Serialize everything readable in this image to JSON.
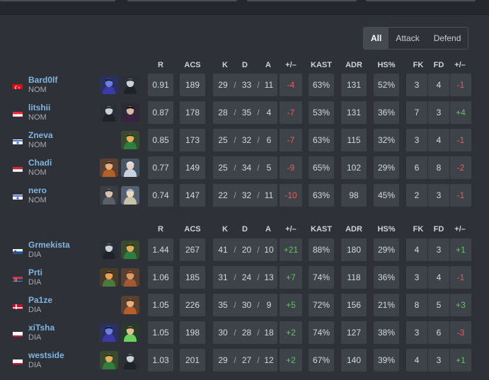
{
  "filters": [
    "All",
    "Attack",
    "Defend"
  ],
  "active_filter": "All",
  "columns": {
    "r": "R",
    "acs": "ACS",
    "k": "K",
    "d": "D",
    "a": "A",
    "pm": "+/–",
    "kast": "KAST",
    "adr": "ADR",
    "hs": "HS%",
    "fk": "FK",
    "fd": "FD",
    "fkfd": "+/–"
  },
  "colors": {
    "positive": "#62c462",
    "negative": "#e35e5e",
    "link": "#7fb5e0"
  },
  "teams": [
    {
      "players": [
        {
          "name": "Bard0lf",
          "team": "NOM",
          "flag": "turkey-flag",
          "agents": [
            "omen",
            "viper"
          ],
          "r": "0.91",
          "acs": "189",
          "k": "29",
          "d": "33",
          "a": "11",
          "pm": "-4",
          "kast": "63%",
          "adr": "131",
          "hs": "52%",
          "fk": "3",
          "fd": "4",
          "fkfd": "-1"
        },
        {
          "name": "litshii",
          "team": "NOM",
          "flag": "austria-flag",
          "agents": [
            "viper",
            "reyna"
          ],
          "r": "0.87",
          "acs": "178",
          "k": "28",
          "d": "35",
          "a": "4",
          "pm": "-7",
          "kast": "53%",
          "adr": "131",
          "hs": "36%",
          "fk": "7",
          "fd": "3",
          "fkfd": "+4"
        },
        {
          "name": "Zneva",
          "team": "NOM",
          "flag": "israel-flag",
          "agents": [
            "skye"
          ],
          "r": "0.85",
          "acs": "173",
          "k": "25",
          "d": "32",
          "a": "6",
          "pm": "-7",
          "kast": "63%",
          "adr": "115",
          "hs": "32%",
          "fk": "3",
          "fd": "4",
          "fkfd": "-1"
        },
        {
          "name": "Chadi",
          "team": "NOM",
          "flag": "hungary-flag",
          "agents": [
            "breach",
            "jett"
          ],
          "r": "0.77",
          "acs": "149",
          "k": "25",
          "d": "34",
          "a": "5",
          "pm": "-9",
          "kast": "65%",
          "adr": "102",
          "hs": "29%",
          "fk": "6",
          "fd": "8",
          "fkfd": "-2"
        },
        {
          "name": "nero",
          "team": "NOM",
          "flag": "israel-flag",
          "agents": [
            "fade",
            "sova"
          ],
          "r": "0.74",
          "acs": "147",
          "k": "22",
          "d": "32",
          "a": "11",
          "pm": "-10",
          "kast": "63%",
          "adr": "98",
          "hs": "45%",
          "fk": "2",
          "fd": "3",
          "fkfd": "-1"
        }
      ]
    },
    {
      "players": [
        {
          "name": "Grmekista",
          "team": "DIA",
          "flag": "slovenia-flag",
          "agents": [
            "viper",
            "skye"
          ],
          "r": "1.44",
          "acs": "267",
          "k": "41",
          "d": "20",
          "a": "10",
          "pm": "+21",
          "kast": "88%",
          "adr": "180",
          "hs": "29%",
          "fk": "4",
          "fd": "3",
          "fkfd": "+1"
        },
        {
          "name": "Prti",
          "team": "DIA",
          "flag": "serbia-flag",
          "agents": [
            "kayo",
            "sova2"
          ],
          "r": "1.06",
          "acs": "185",
          "k": "31",
          "d": "24",
          "a": "13",
          "pm": "+7",
          "kast": "74%",
          "adr": "118",
          "hs": "36%",
          "fk": "3",
          "fd": "4",
          "fkfd": "-1"
        },
        {
          "name": "Pa1ze",
          "team": "DIA",
          "flag": "denmark-flag",
          "agents": [
            "breach"
          ],
          "r": "1.05",
          "acs": "226",
          "k": "35",
          "d": "30",
          "a": "9",
          "pm": "+5",
          "kast": "72%",
          "adr": "156",
          "hs": "21%",
          "fk": "8",
          "fd": "5",
          "fkfd": "+3"
        },
        {
          "name": "xiTsha",
          "team": "DIA",
          "flag": "poland-flag",
          "agents": [
            "omen",
            "raze"
          ],
          "r": "1.05",
          "acs": "198",
          "k": "30",
          "d": "28",
          "a": "18",
          "pm": "+2",
          "kast": "74%",
          "adr": "127",
          "hs": "38%",
          "fk": "3",
          "fd": "6",
          "fkfd": "-3"
        },
        {
          "name": "westside",
          "team": "DIA",
          "flag": "poland-flag",
          "agents": [
            "skye",
            "viper"
          ],
          "r": "1.03",
          "acs": "201",
          "k": "29",
          "d": "27",
          "a": "12",
          "pm": "+2",
          "kast": "67%",
          "adr": "140",
          "hs": "39%",
          "fk": "4",
          "fd": "3",
          "fkfd": "+1"
        }
      ]
    }
  ]
}
